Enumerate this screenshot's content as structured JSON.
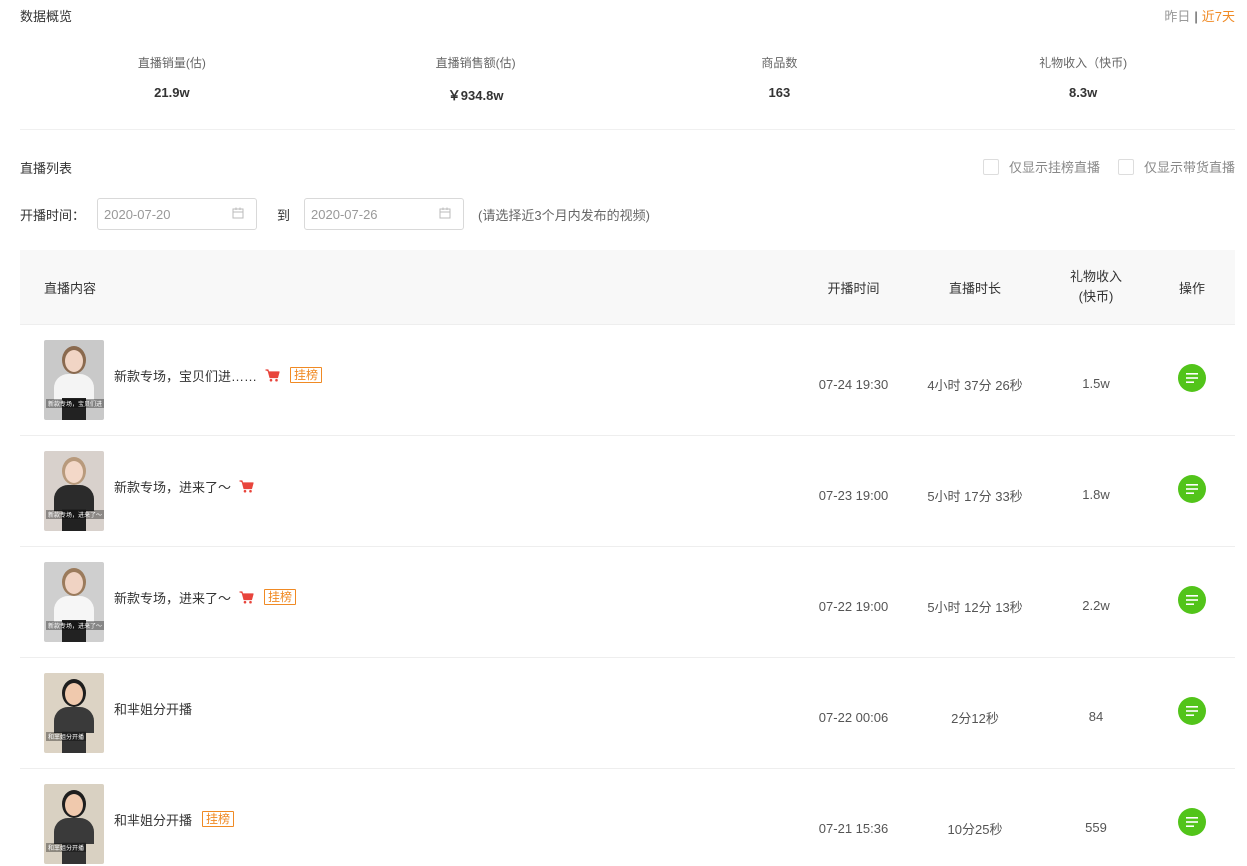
{
  "overview": {
    "title": "数据概览",
    "range": {
      "yesterday": "昨日",
      "separator": "|",
      "last7": "近7天"
    },
    "stats": [
      {
        "label": "直播销量(估)",
        "value": "21.9w"
      },
      {
        "label": "直播销售额(估)",
        "value": "￥934.8w"
      },
      {
        "label": "商品数",
        "value": "163"
      },
      {
        "label": "礼物收入（快币)",
        "value": "8.3w"
      }
    ]
  },
  "list": {
    "title": "直播列表",
    "filters": {
      "only_ranked": "仅显示挂榜直播",
      "only_selling": "仅显示带货直播"
    },
    "date": {
      "label": "开播时间：",
      "start": "2020-07-20",
      "to": "到",
      "end": "2020-07-26",
      "hint": "(请选择近3个月内发布的视频)"
    },
    "columns": {
      "content": "直播内容",
      "start_time": "开播时间",
      "duration": "直播时长",
      "gift": "礼物收入",
      "gift_unit": "(快币)",
      "action": "操作"
    },
    "rows": [
      {
        "title": "新款专场，宝贝们进……",
        "caption": "新款专场，宝贝们进",
        "cart": true,
        "tag": "挂榜",
        "start": "07-24 19:30",
        "duration": "4小时 37分 26秒",
        "gift": "1.5w"
      },
      {
        "title": "新款专场，进来了～",
        "caption": "新款专场，进来了～",
        "cart": true,
        "tag": "",
        "start": "07-23 19:00",
        "duration": "5小时 17分 33秒",
        "gift": "1.8w"
      },
      {
        "title": "新款专场，进来了～",
        "caption": "新款专场，进来了～",
        "cart": true,
        "tag": "挂榜",
        "start": "07-22 19:00",
        "duration": "5小时 12分 13秒",
        "gift": "2.2w"
      },
      {
        "title": "和芈姐分开播",
        "caption": "和芈姐分开播",
        "cart": false,
        "tag": "",
        "start": "07-22 00:06",
        "duration": "2分12秒",
        "gift": "84"
      },
      {
        "title": "和芈姐分开播",
        "caption": "和芈姐分开播",
        "cart": false,
        "tag": "挂榜",
        "start": "07-21 15:36",
        "duration": "10分25秒",
        "gift": "559"
      }
    ]
  },
  "colors": {
    "accent": "#f08a24",
    "cart": "#e8453c",
    "action": "#52c41a"
  },
  "icons": {
    "date": "calendar-icon",
    "cart": "cart-icon",
    "action": "list-icon"
  }
}
